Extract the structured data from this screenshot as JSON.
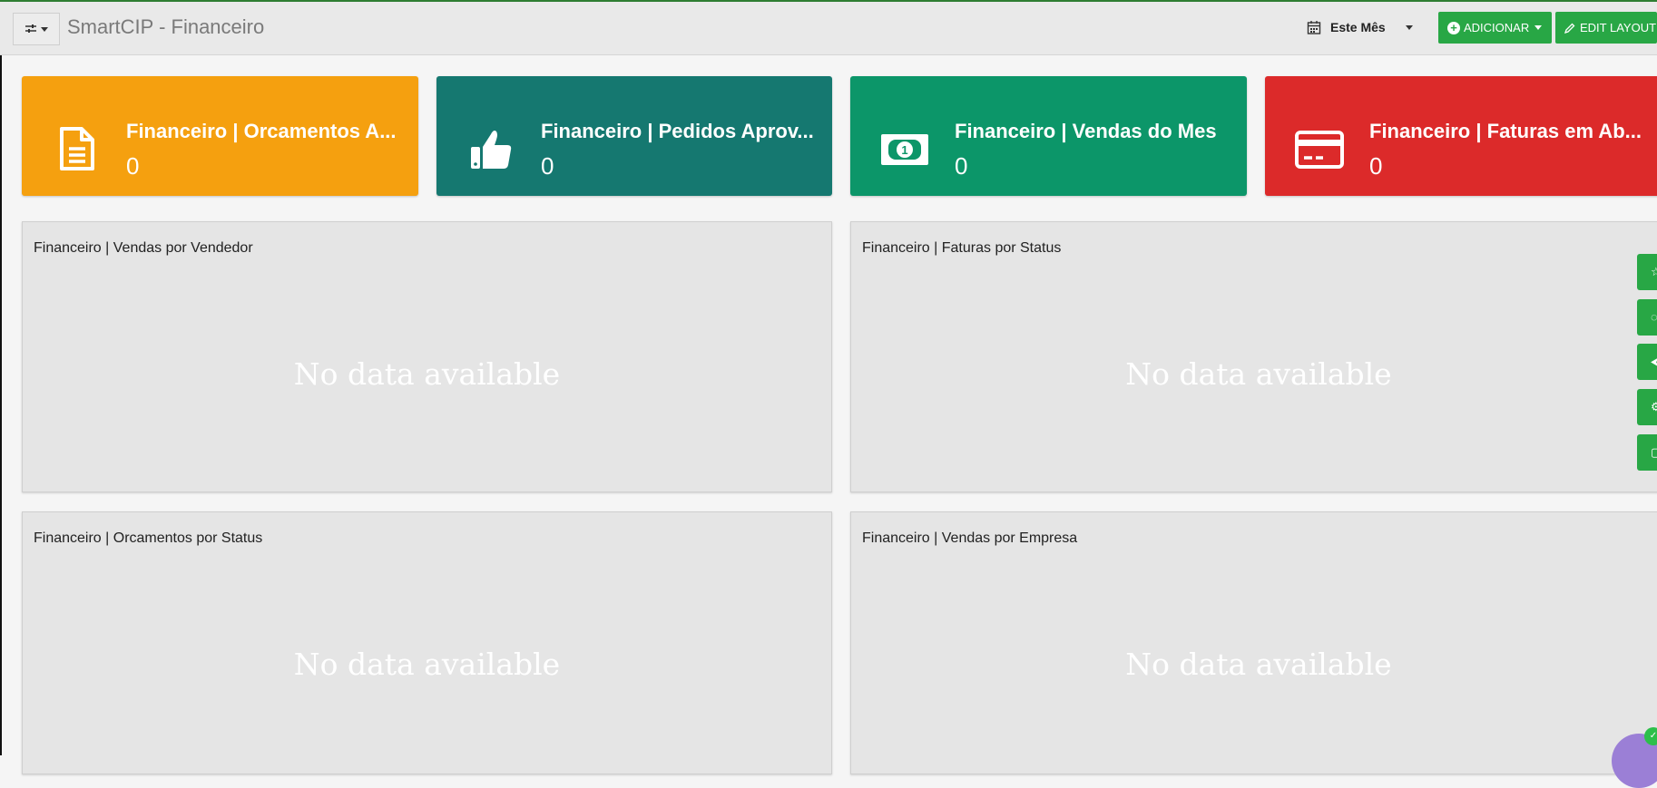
{
  "header": {
    "title": "SmartCIP - Financeiro",
    "period_label": "Este Mês",
    "add_label": "ADICIONAR",
    "edit_layout_label": "EDIT LAYOUT"
  },
  "kpis": [
    {
      "title": "Financeiro | Orcamentos A...",
      "value": "0",
      "color": "#f5a00f",
      "icon": "document-icon"
    },
    {
      "title": "Financeiro | Pedidos Aprov...",
      "value": "0",
      "color": "#157870",
      "icon": "thumbs-up-icon"
    },
    {
      "title": "Financeiro | Vendas do Mes",
      "value": "0",
      "color": "#0c9669",
      "icon": "money-bill-icon"
    },
    {
      "title": "Financeiro | Faturas em Ab...",
      "value": "0",
      "color": "#dc2a2a",
      "icon": "credit-card-icon"
    }
  ],
  "panels": [
    {
      "title": "Financeiro | Vendas por Vendedor",
      "empty_text": "No data available"
    },
    {
      "title": "Financeiro | Faturas por Status",
      "empty_text": "No data available"
    },
    {
      "title": "Financeiro | Orcamentos por Status",
      "empty_text": "No data available"
    },
    {
      "title": "Financeiro | Vendas por Empresa",
      "empty_text": "No data available"
    }
  ],
  "side_actions": [
    {
      "glyph": "☆",
      "icon": "star-icon"
    },
    {
      "glyph": "◌",
      "icon": "refresh-icon"
    },
    {
      "glyph": "⮜",
      "icon": "share-icon"
    },
    {
      "glyph": "⚙",
      "icon": "gear-icon"
    },
    {
      "glyph": "▢",
      "icon": "screen-icon"
    }
  ],
  "chat_badge": "✓",
  "colors": {
    "accent_green": "#28a745",
    "panel_bg": "#e5e5e5"
  }
}
